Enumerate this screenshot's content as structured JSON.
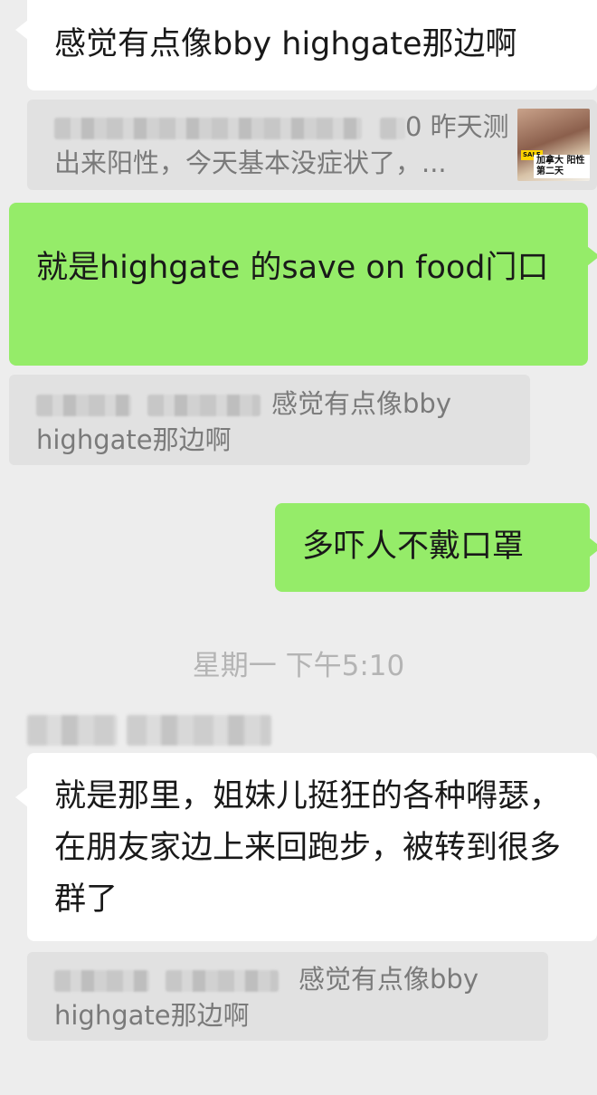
{
  "messages": [
    {
      "text": "感觉有点像bby highgate那边啊"
    },
    {
      "quote_tail": "0 昨天测",
      "quote_line2": "出来阳性，今天基本没症状了，...",
      "thumb_caption": "加拿大 阳性第二天",
      "thumb_tag": "SALE"
    },
    {
      "text": "就是highgate 的save on food门口"
    },
    {
      "quote_tail": "感觉有点像bby",
      "quote_line2": "highgate那边啊"
    },
    {
      "text": "多吓人不戴口罩"
    },
    {
      "timestamp": "星期一 下午5:10"
    },
    {
      "text": "就是那里，姐妹儿挺狂的各种嘚瑟，在朋友家边上来回跑步，被转到很多群了"
    },
    {
      "quote_tail": "感觉有点像bby",
      "quote_line2": "highgate那边啊"
    }
  ],
  "colors": {
    "background": "#ededed",
    "incoming_bubble": "#ffffff",
    "outgoing_bubble": "#95ec69",
    "quote_bg": "#e1e1e1"
  }
}
